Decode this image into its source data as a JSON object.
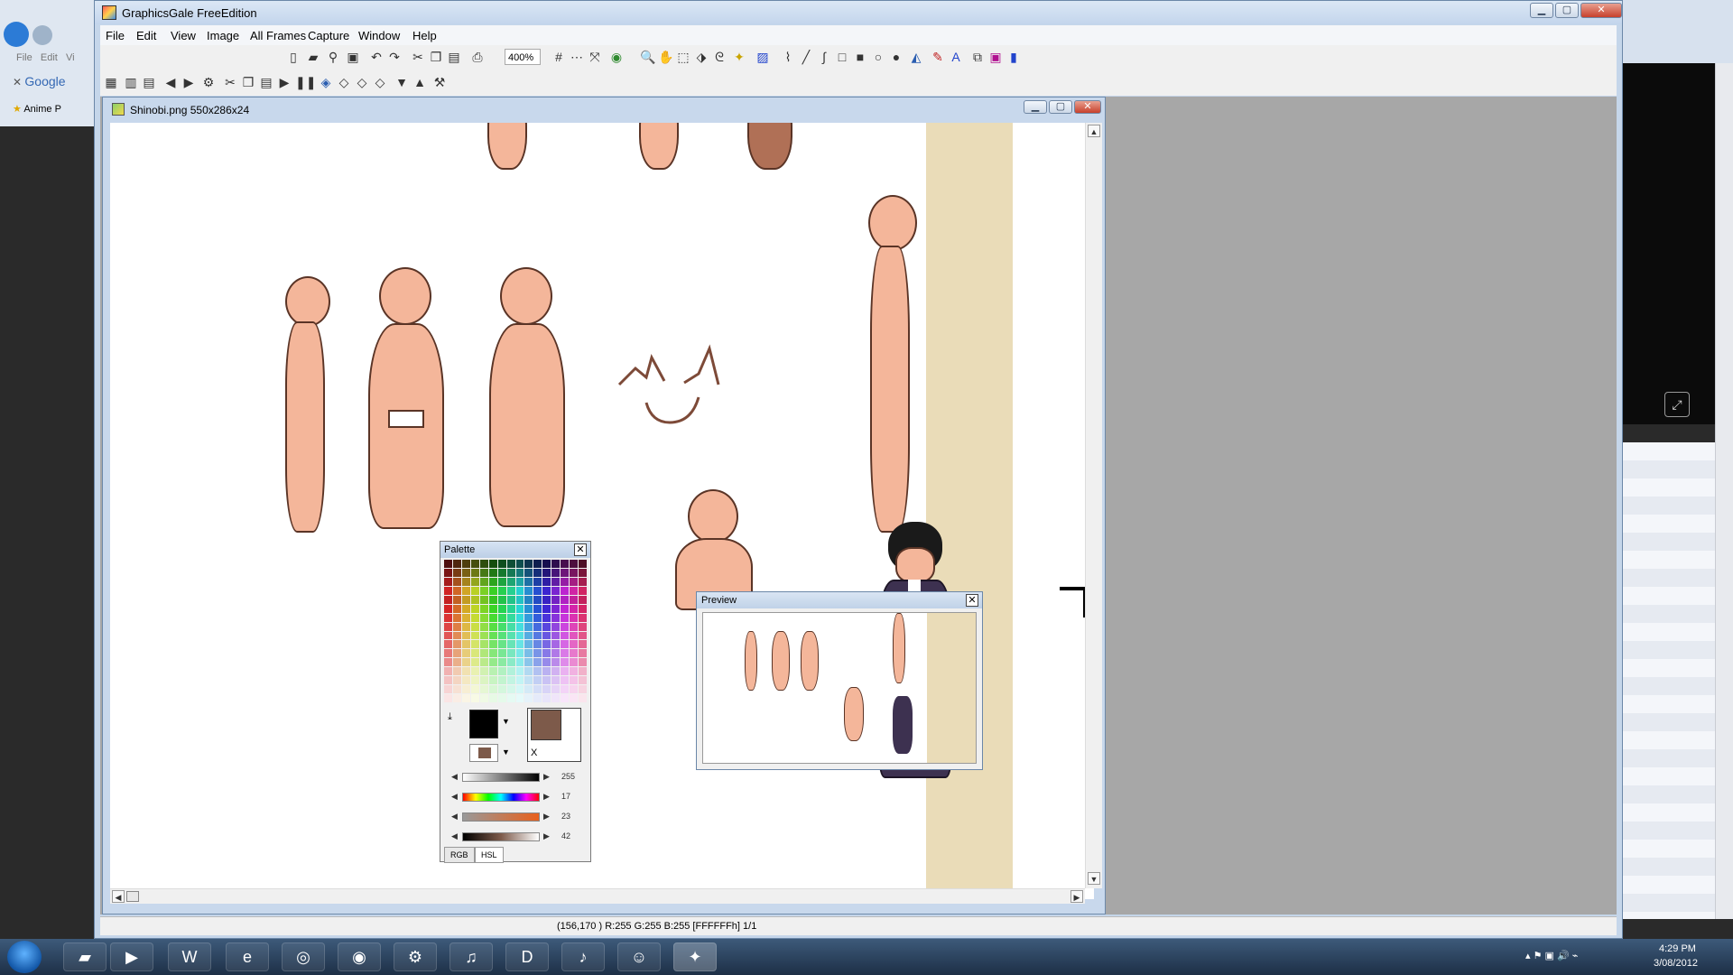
{
  "window": {
    "title": "GraphicsGale FreeEdition"
  },
  "menu": [
    "File",
    "Edit",
    "View",
    "Image",
    "All Frames",
    "Capture",
    "Window",
    "Help"
  ],
  "toolbar": {
    "zoom": "400%"
  },
  "document": {
    "title": "Shinobi.png 550x286x24"
  },
  "palette": {
    "title": "Palette",
    "slider_values": [
      "255",
      "17",
      "23",
      "42"
    ],
    "tabs": [
      "RGB",
      "HSL"
    ],
    "fg_color": "#000000",
    "bg_color": "#7d5a4a"
  },
  "preview": {
    "title": "Preview"
  },
  "status": {
    "text": "(156,170 ) R:255 G:255 B:255  [FFFFFFh] 1/1"
  },
  "browser": {
    "menu_file": "File",
    "menu_edit": "Edit",
    "menu_view": "Vi",
    "google": "Google",
    "bookmark": "Anime P"
  },
  "clock": {
    "time": "4:29 PM",
    "date": "3/08/2012"
  },
  "colors": {
    "canvas_beige": "#eadcb8",
    "skin": "#f4b69a",
    "outline": "#5a3426",
    "robe": "#3d3150"
  }
}
